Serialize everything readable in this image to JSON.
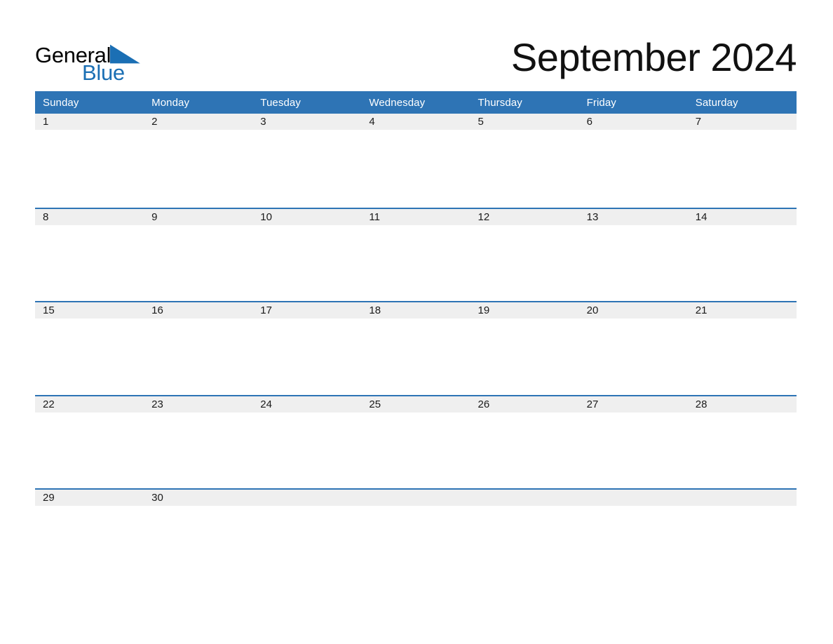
{
  "brand": {
    "name_part1": "General",
    "name_part2": "Blue",
    "triangle_icon": "blue-right-triangle",
    "accent_color": "#1B6FB4"
  },
  "header": {
    "title": "September 2024",
    "month": "September",
    "year": "2024"
  },
  "colors": {
    "header_blue": "#2E74B5",
    "date_band_gray": "#EFEFEF",
    "page_background": "#FFFFFF",
    "title_text": "#111111",
    "weekday_text": "#FFFFFF",
    "date_text": "#1A1A1A"
  },
  "calendar": {
    "weekdays": [
      "Sunday",
      "Monday",
      "Tuesday",
      "Wednesday",
      "Thursday",
      "Friday",
      "Saturday"
    ],
    "weeks": [
      {
        "days": [
          "1",
          "2",
          "3",
          "4",
          "5",
          "6",
          "7"
        ]
      },
      {
        "days": [
          "8",
          "9",
          "10",
          "11",
          "12",
          "13",
          "14"
        ]
      },
      {
        "days": [
          "15",
          "16",
          "17",
          "18",
          "19",
          "20",
          "21"
        ]
      },
      {
        "days": [
          "22",
          "23",
          "24",
          "25",
          "26",
          "27",
          "28"
        ]
      },
      {
        "days": [
          "29",
          "30",
          "",
          "",
          "",
          "",
          ""
        ]
      }
    ]
  }
}
